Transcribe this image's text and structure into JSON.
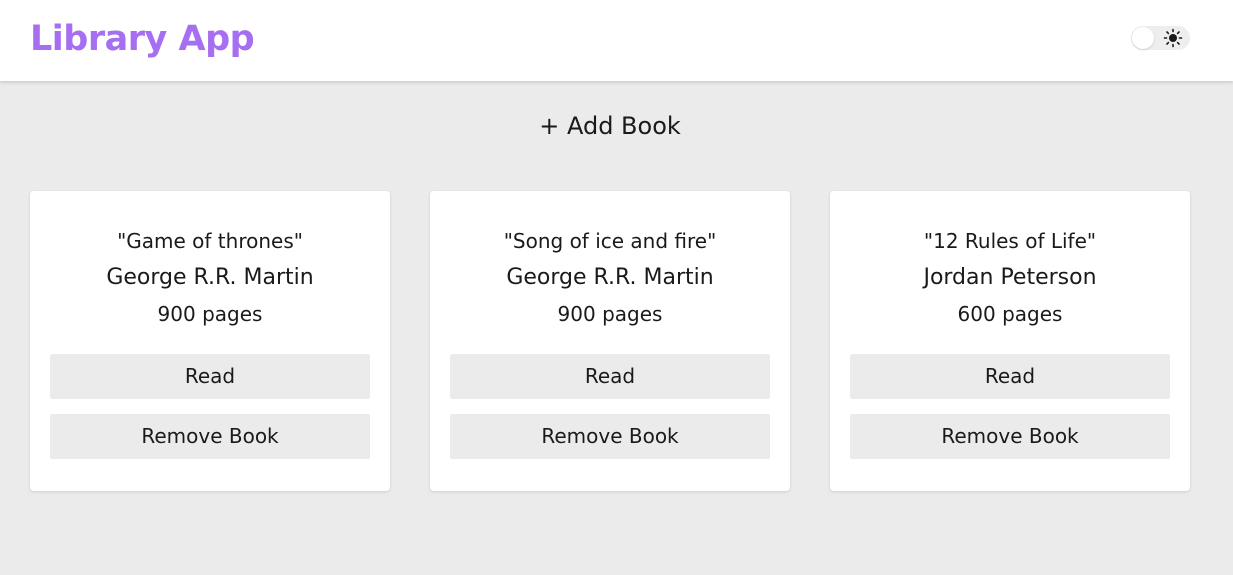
{
  "header": {
    "title": "Library App",
    "title_color": "#a66ef0",
    "theme_toggle": {
      "icon": "sun-icon",
      "state": "light"
    }
  },
  "main": {
    "add_book_label": "+ Add Book",
    "books": [
      {
        "title": "\"Game of thrones\"",
        "author": "George R.R. Martin",
        "pages": "900 pages",
        "read_label": "Read",
        "remove_label": "Remove Book"
      },
      {
        "title": "\"Song of ice and fire\"",
        "author": "George R.R. Martin",
        "pages": "900 pages",
        "read_label": "Read",
        "remove_label": "Remove Book"
      },
      {
        "title": "\"12 Rules of Life\"",
        "author": "Jordan Peterson",
        "pages": "600 pages",
        "read_label": "Read",
        "remove_label": "Remove Book"
      }
    ]
  }
}
